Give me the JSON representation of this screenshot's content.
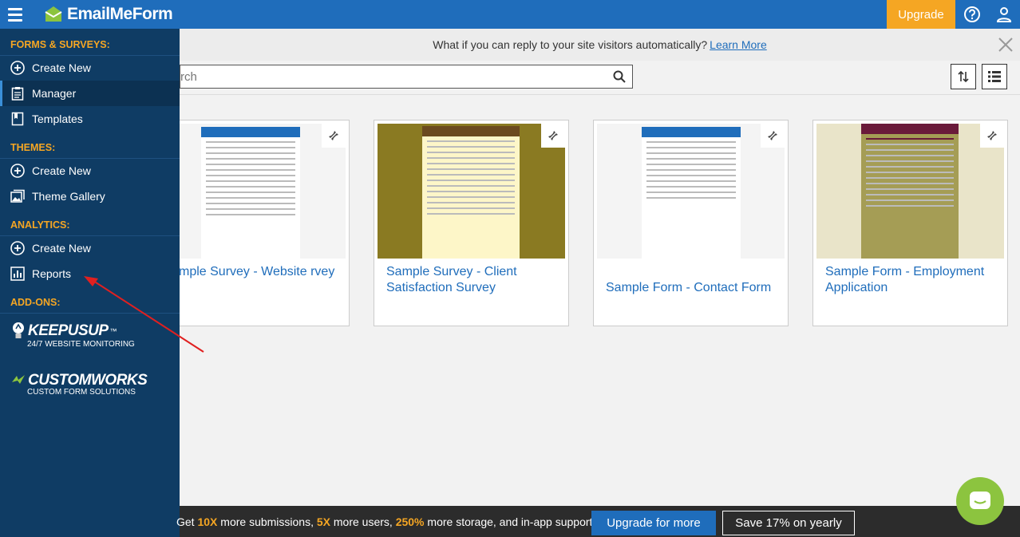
{
  "app": {
    "logo_text": "EmailMeForm",
    "upgrade_label": "Upgrade"
  },
  "notice": {
    "text": "What if you can reply to your site visitors automatically?",
    "link": "Learn More"
  },
  "search": {
    "placeholder": "rch"
  },
  "sidebar": {
    "forms_head": "FORMS & SURVEYS:",
    "forms_create": "Create New",
    "forms_manager": "Manager",
    "forms_templates": "Templates",
    "themes_head": "THEMES:",
    "themes_create": "Create New",
    "themes_gallery": "Theme Gallery",
    "analytics_head": "ANALYTICS:",
    "analytics_create": "Create New",
    "analytics_reports": "Reports",
    "addons_head": "ADD-ONS:",
    "keepusup": "KEEPUSUP",
    "keepusup_tm": "™",
    "keepusup_sub": "24/7 WEBSITE MONITORING",
    "customworks": "CUSTOMWORKS",
    "customworks_sub": "CUSTOM FORM SOLUTIONS"
  },
  "cards": [
    {
      "title": "mple Survey - Website rvey"
    },
    {
      "title": "Sample Survey - Client Satisfaction Survey"
    },
    {
      "title": "Sample Form - Contact Form"
    },
    {
      "title": "Sample Form - Employment Application"
    }
  ],
  "promo": {
    "pre": "Get ",
    "n1": "10X",
    "t1": " more submissions, ",
    "n2": "5X",
    "t2": " more users, ",
    "n3": "250%",
    "t3": " more storage, and in-app support.",
    "btn_upgrade": "Upgrade for more",
    "btn_save": "Save 17% on yearly"
  },
  "colors": {
    "primary": "#1f6dbb",
    "sidebar": "#0f3c64",
    "accent": "#f5a623",
    "chat": "#8cc43f"
  }
}
